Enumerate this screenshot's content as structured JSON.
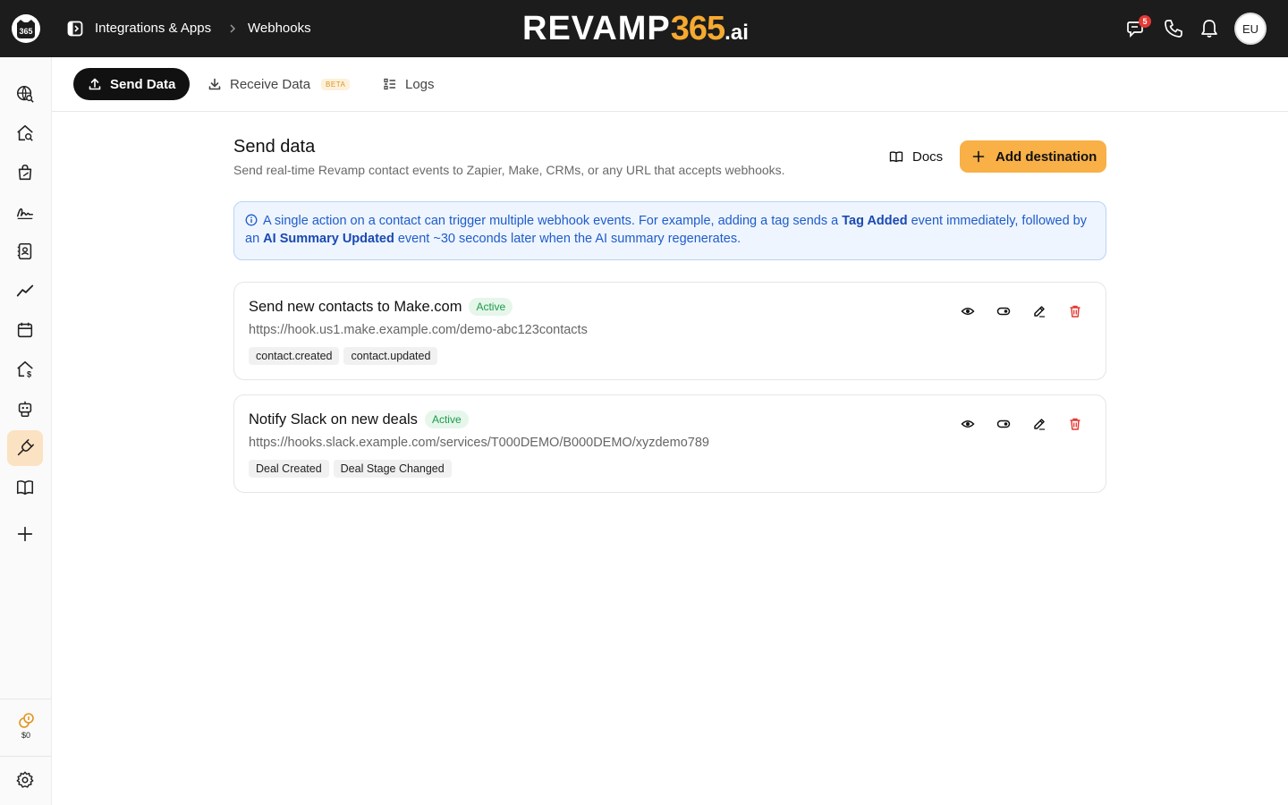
{
  "topbar": {
    "breadcrumb": [
      "Integrations & Apps",
      "Webhooks"
    ],
    "brand": {
      "main": "REVAMP",
      "number": "365",
      "suffix": ".ai"
    },
    "logo_text": "365",
    "notification_count": "5",
    "user_initials": "EU",
    "icons": [
      "chat-icon",
      "phone-icon",
      "bell-icon"
    ]
  },
  "sidebar": {
    "items": [
      "globe-search-icon",
      "home-search-icon",
      "bag-icon",
      "signature-icon",
      "contacts-icon",
      "trend-icon",
      "calendar-icon",
      "home-dollar-icon",
      "robot-icon",
      "plug-icon",
      "book-icon",
      "plus-icon"
    ],
    "active": "plug-icon",
    "credits": "$0"
  },
  "tabs": [
    {
      "label": "Send Data",
      "active": true
    },
    {
      "label": "Receive Data",
      "badge": "BETA"
    },
    {
      "label": "Logs"
    }
  ],
  "header": {
    "title": "Send data",
    "subtitle": "Send real-time Revamp contact events to Zapier, Make, CRMs, or any URL that accepts webhooks.",
    "docs_label": "Docs",
    "add_label": "Add destination"
  },
  "info": {
    "part1": "A single action on a contact can trigger multiple webhook events. For example, adding a tag sends a",
    "bold1": "Tag Added",
    "part2": "event immediately, followed by an",
    "bold2": "AI Summary Updated",
    "part3": "event ~30 seconds later when the AI summary regenerates."
  },
  "destinations": [
    {
      "name": "Send new contacts to Make.com",
      "status": "Active",
      "url": "https://hook.us1.make.example.com/demo-abc123contacts",
      "events": [
        "contact.created",
        "contact.updated"
      ]
    },
    {
      "name": "Notify Slack on new deals",
      "status": "Active",
      "url": "https://hooks.slack.example.com/services/T000DEMO/B000DEMO/xyzdemo789",
      "events": [
        "Deal Created",
        "Deal Stage Changed"
      ]
    }
  ],
  "colors": {
    "accent": "#f8b047",
    "topbar": "#1c1c1c",
    "active_status": "#1c9a4b",
    "info_text": "#1f5ccb",
    "delete": "#e53935"
  }
}
